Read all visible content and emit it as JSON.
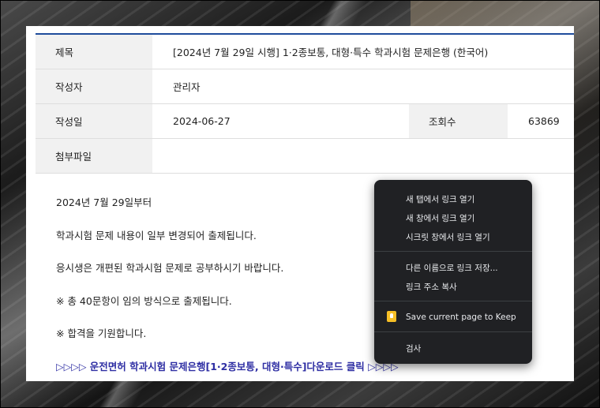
{
  "post": {
    "title_label": "제목",
    "title_value": "[2024년 7월 29일 시행] 1·2종보통, 대형·특수 학과시험 문제은행 (한국어)",
    "author_label": "작성자",
    "author_value": "관리자",
    "date_label": "작성일",
    "date_value": "2024-06-27",
    "views_label": "조회수",
    "views_value": "63869",
    "attachment_label": "첨부파일"
  },
  "content": {
    "paragraphs": [
      "2024년 7월 29일부터",
      "학과시험 문제 내용이 일부 변경되어 출제됩니다.",
      "응시생은 개편된 학과시험 문제로 공부하시기 바랍니다.",
      "※ 총 40문항이 임의 방식으로 출제됩니다.",
      "※ 합격을 기원합니다."
    ],
    "download_link": "▷▷▷▷ 운전면허 학과시험 문제은행[1·2종보통, 대형·특수]다운로드 클릭 ▷▷▷▷"
  },
  "context_menu": {
    "items": [
      "새 탭에서 링크 열기",
      "새 창에서 링크 열기",
      "시크릿 창에서 링크 열기",
      "다른 이름으로 링크 저장...",
      "링크 주소 복사",
      "Save current page to Keep",
      "검사"
    ],
    "keep_icon_color": "#f6bf26"
  },
  "colors": {
    "accent": "#1f4c9c",
    "link": "#2e2ea3",
    "menu_bg": "#202124"
  }
}
